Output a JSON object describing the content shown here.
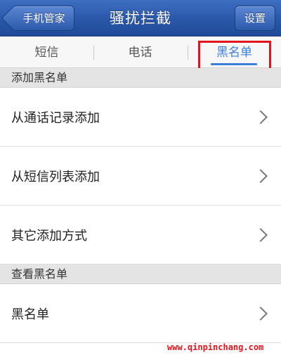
{
  "header": {
    "back_label": "手机管家",
    "title": "骚扰拦截",
    "settings_label": "设置"
  },
  "tabs": [
    {
      "label": "短信",
      "active": false
    },
    {
      "label": "电话",
      "active": false
    },
    {
      "label": "黑名单",
      "active": true
    }
  ],
  "sections": {
    "add": {
      "header": "添加黑名单",
      "items": [
        {
          "label": "从通话记录添加"
        },
        {
          "label": "从短信列表添加"
        },
        {
          "label": "其它添加方式"
        }
      ]
    },
    "view": {
      "header": "查看黑名单",
      "items": [
        {
          "label": "黑名单"
        }
      ]
    }
  },
  "watermark": "www.qinpinchang.com",
  "colors": {
    "titlebar": "#2a57a8",
    "active_tab": "#3d7fd8",
    "highlight": "#e0141c"
  }
}
